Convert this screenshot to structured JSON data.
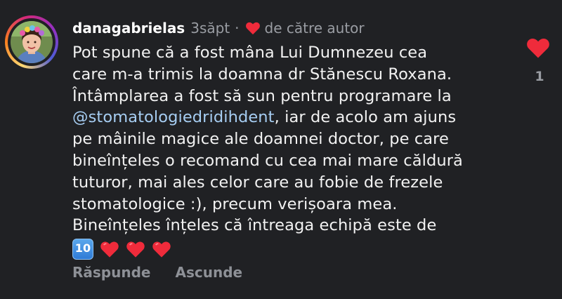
{
  "comment": {
    "username": "danagabrielas",
    "timestamp": "3săpt",
    "separator": "·",
    "by_author": "de către autor",
    "text_lines": [
      {
        "before": "Pot spune că a fost mâna Lui Dumnezeu cea"
      },
      {
        "before": "care m-a trimis la doamna dr Stănescu Roxana."
      },
      {
        "before": "Întâmplarea a fost să sun pentru programare la"
      },
      {
        "mention": "@stomatologiedridihdent",
        "after": ", iar de acolo am ajuns"
      },
      {
        "before": "pe mâinile magice ale doamnei doctor, pe care"
      },
      {
        "before": "bineînțeles o recomand cu cea mai mare căldură"
      },
      {
        "before": "tuturor, mai ales celor care au fobie de frezele"
      },
      {
        "before": "stomatologice :), precum verișoara mea."
      },
      {
        "before": "Bineînțeles înțeles că întreaga echipă este de"
      }
    ],
    "emoji_keycap": "10",
    "emoji_hearts": [
      "red-heart",
      "red-heart",
      "red-heart"
    ],
    "like_count": "1",
    "actions": {
      "reply": "Răspunde",
      "hide": "Ascunde"
    },
    "avatar_icon": "profile-photo",
    "like_icon": "heart-icon",
    "colors": {
      "background": "#202124",
      "text": "#f2f2f2",
      "muted": "#9a9da3",
      "mention": "#a6cdf2",
      "heart": "#ef2b3b"
    }
  }
}
